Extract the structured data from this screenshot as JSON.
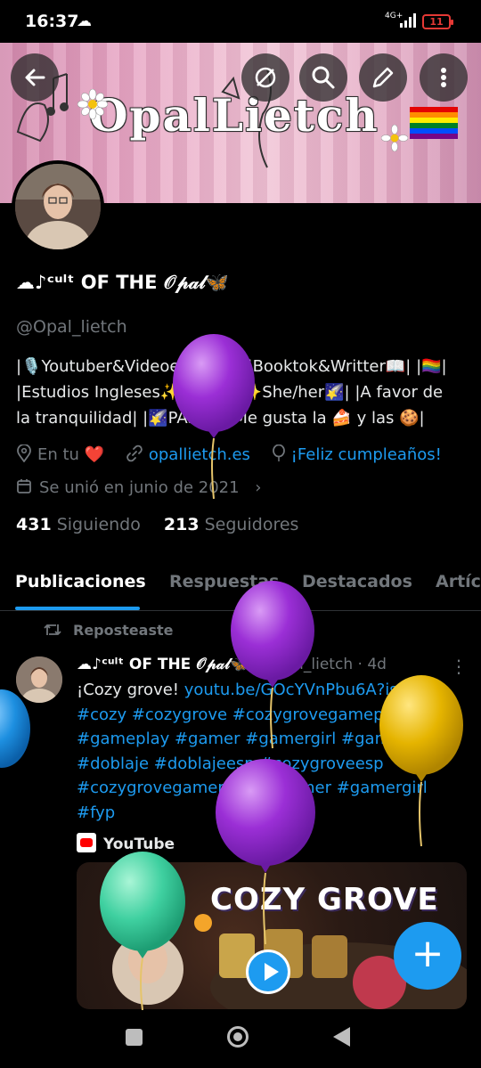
{
  "status_bar": {
    "time": "16:37",
    "network": "4G+",
    "battery": "11"
  },
  "header": {
    "banner_title": "OpalLietch",
    "buttons": [
      "back",
      "mute",
      "search",
      "edit",
      "more"
    ]
  },
  "profile": {
    "name": "☁♪ᶜᵘˡᵗ OF THE 𝒪𝓅𝒶𝓁🦋",
    "handle": "@Opal_lietch",
    "bio_lines": [
      "|🎙️Youtuber&Videoeditor📹| |Booktok&Writter📖| |🏳️‍🌈|",
      "|Estudios Ingleses✨| |🎹♪| |✨She/her🌠| |A favor de",
      "la tranquilidad| |🌠PAS📞| |Me gusta la 🍰 y las 🍪|"
    ],
    "location": "En tu ❤️",
    "website": "opallietch.es",
    "birthday": "¡Feliz cumpleaños!",
    "joined": "Se unió en junio de 2021",
    "following_count": "431",
    "following_label": "Siguiendo",
    "followers_count": "213",
    "followers_label": "Seguidores"
  },
  "tabs": [
    "Publicaciones",
    "Respuestas",
    "Destacados",
    "Artíc"
  ],
  "post": {
    "repost_label": "Reposteaste",
    "author_name": "☁♪ᶜᵘˡᵗ OF THE 𝒪𝓅𝒶𝓁🦋",
    "author_handle": "@Opal_lietch",
    "time": "4d",
    "text_lead": "¡Cozy grove! ",
    "link": "youtu.be/GOcYVnPbu6A?is...",
    "hashtag_lines": [
      "#cozy #cozygrove #cozygrovegameplay",
      "#gameplay #gamer #gamergirl #gamertwt",
      "#doblaje #doblajeesp #cozygroveesp",
      "#cozygrovegamer #cozygamer #gamergirl",
      "#fyp"
    ],
    "card_source": "YouTube",
    "thumbnail_title": "COZY GROVE"
  },
  "fab_label": "+",
  "colors": {
    "accent": "#1d9bf0",
    "muted": "#71767b",
    "balloon_purple": "#9b2fd6",
    "balloon_gold": "#e5b400",
    "balloon_teal": "#3fd0a0"
  }
}
